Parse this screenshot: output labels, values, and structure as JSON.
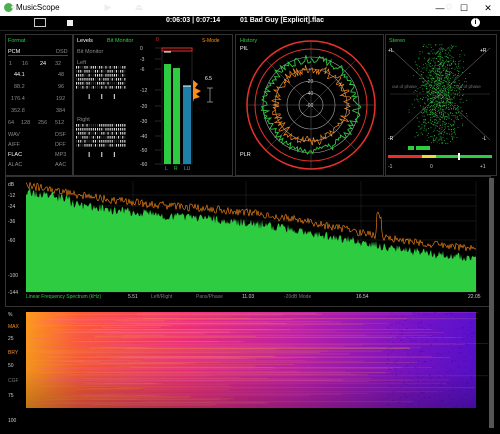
{
  "window": {
    "title": "MusicScope",
    "minimize": "—",
    "maximize": "☐",
    "close": "✕"
  },
  "toolbar": {
    "time_current": "0:06:03",
    "time_sep": "|",
    "time_total": "0:07:14",
    "track": "01 Bad Guy [Explicit].flac"
  },
  "format": {
    "title": "Format",
    "pcm": "PCM",
    "dsd": "DSD",
    "bits": [
      "1",
      "16",
      "24",
      "32"
    ],
    "rates_left": [
      "44.1",
      "88.2",
      "176.4",
      "352.8"
    ],
    "rates_right": [
      "48",
      "96",
      "192",
      "384"
    ],
    "dsd_rates": [
      "64",
      "128",
      "256",
      "512"
    ],
    "codecs_left": [
      "WAV",
      "AIFF",
      "FLAC",
      "ALAC"
    ],
    "codecs_right": [
      "DSF",
      "DFF",
      "MP3",
      "AAC"
    ]
  },
  "levels": {
    "title": "Levels",
    "bit_monitor": "Bit Monitor",
    "left": "Left",
    "right": "Right",
    "scale": [
      "0",
      "-3",
      "-6",
      "-12",
      "-20",
      "-30",
      "-40",
      "-50",
      "-60"
    ],
    "channel_labels": [
      "L",
      "R",
      "LU"
    ],
    "dr_value": "6.5",
    "s_mode": "S-Mode",
    "peak_marker": "0"
  },
  "history": {
    "title": "History",
    "pil": "PIL",
    "plr": "PLR",
    "rings": [
      "-20",
      "-40",
      "-60"
    ]
  },
  "stereo": {
    "title": "Stereo",
    "tl": "+L",
    "tr": "+R",
    "bl": "-R",
    "br": "-L",
    "oop_left": "out of phase",
    "oop_right": "out of phase",
    "corr_min": "-1",
    "corr_mid": "0",
    "corr_max": "+1"
  },
  "spectrum": {
    "y_labels": [
      "dB",
      "-12",
      "-24",
      "-36",
      "-60",
      "-100",
      "-144"
    ],
    "x_title": "Linear Frequency Spectrum (kHz)",
    "x_ticks": [
      "5.51",
      "11.03",
      "16.54",
      "22.05"
    ],
    "modes": [
      "Left/Right",
      "Pans/Phase",
      "-20dB Mode"
    ]
  },
  "spectrogram": {
    "y_labels": [
      "%",
      "MAX",
      "25",
      "BRY",
      "50",
      "CGF",
      "75",
      "100"
    ]
  },
  "colors": {
    "green": "#2ecc40",
    "orange": "#ff8c1a",
    "red": "#e8302a",
    "accent": "#4caf50"
  }
}
